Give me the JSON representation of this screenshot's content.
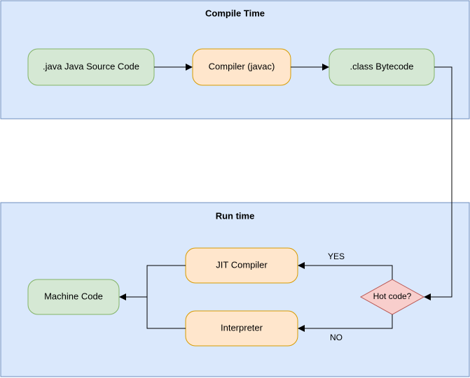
{
  "top": {
    "title": "Compile Time",
    "source": ".java Java Source Code",
    "compiler": "Compiler (javac)",
    "bytecode": ".class Bytecode"
  },
  "bottom": {
    "title": "Run time",
    "jit": "JIT Compiler",
    "interp": "Interpreter",
    "machine": "Machine Code",
    "decision": "Hot code?",
    "yes": "YES",
    "no": "NO"
  }
}
